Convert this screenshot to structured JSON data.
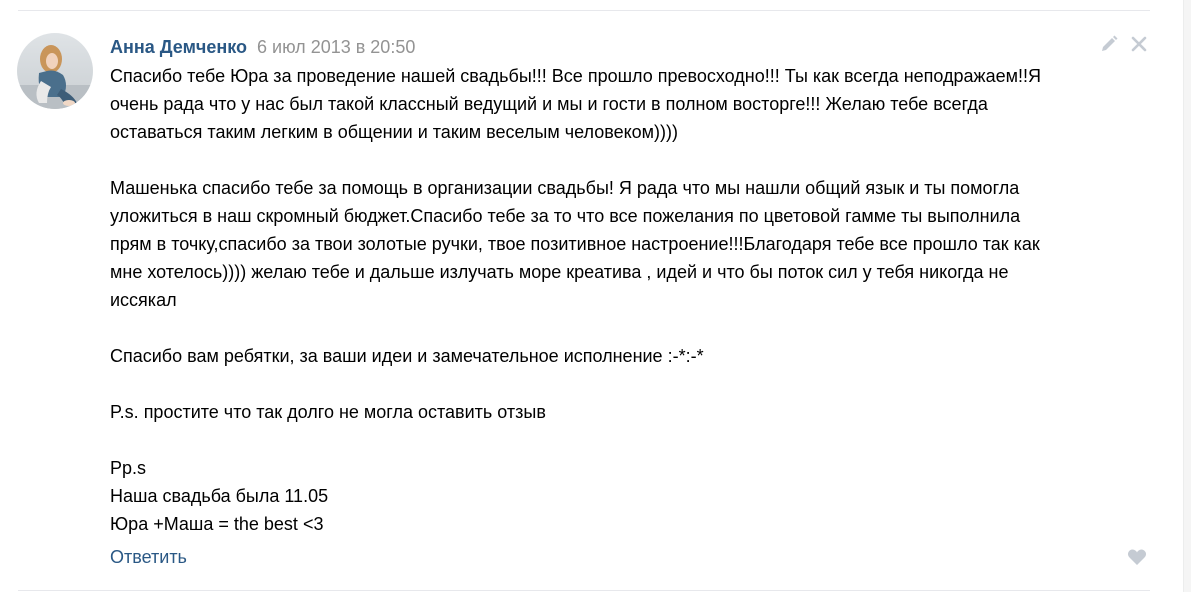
{
  "post": {
    "author": "Анна Демченко",
    "date": "6 июл 2013 в 20:50",
    "paragraphs": [
      {
        "lines": [
          "Спасибо тебе Юра за проведение нашей свадьбы!!! Все прошло превосходно!!! Ты как всегда неподражаем!!Я",
          "очень рада что у нас был такой классный ведущий и мы и гости в полном восторге!!! Желаю тебе всегда",
          "оставаться таким легким в общении и таким веселым человеком))))"
        ]
      },
      {
        "lines": [
          "Машенька спасибо тебе за помощь в организации свадьбы! Я рада что мы нашли общий язык и ты помогла",
          "уложиться в наш скромный бюджет.Спасибо тебе за то что все пожелания по цветовой гамме ты выполнила",
          "прям в точку,спасибо за твои золотые ручки, твое позитивное настроение!!!Благодаря тебе все прошло так как",
          "мне хотелось)))) желаю тебе и дальше излучать море креатива , идей и что бы поток сил у тебя никогда не",
          "иссякал"
        ]
      },
      {
        "lines": [
          "Спасибо вам ребятки, за ваши идеи и замечательное исполнение :-*:-*"
        ]
      },
      {
        "lines": [
          "P.s. простите что так долго не могла оставить отзыв"
        ]
      },
      {
        "lines": [
          "Pp.s",
          "Наша свадьба была 11.05",
          "Юра +Маша = the best <3"
        ]
      }
    ],
    "reply_label": "Ответить"
  },
  "icons": {
    "edit": "pencil-icon",
    "close": "close-icon",
    "like": "heart-icon"
  },
  "colors": {
    "link": "#2a5885",
    "date": "#939393",
    "icon": "#c5cbd3",
    "text": "#000000"
  }
}
